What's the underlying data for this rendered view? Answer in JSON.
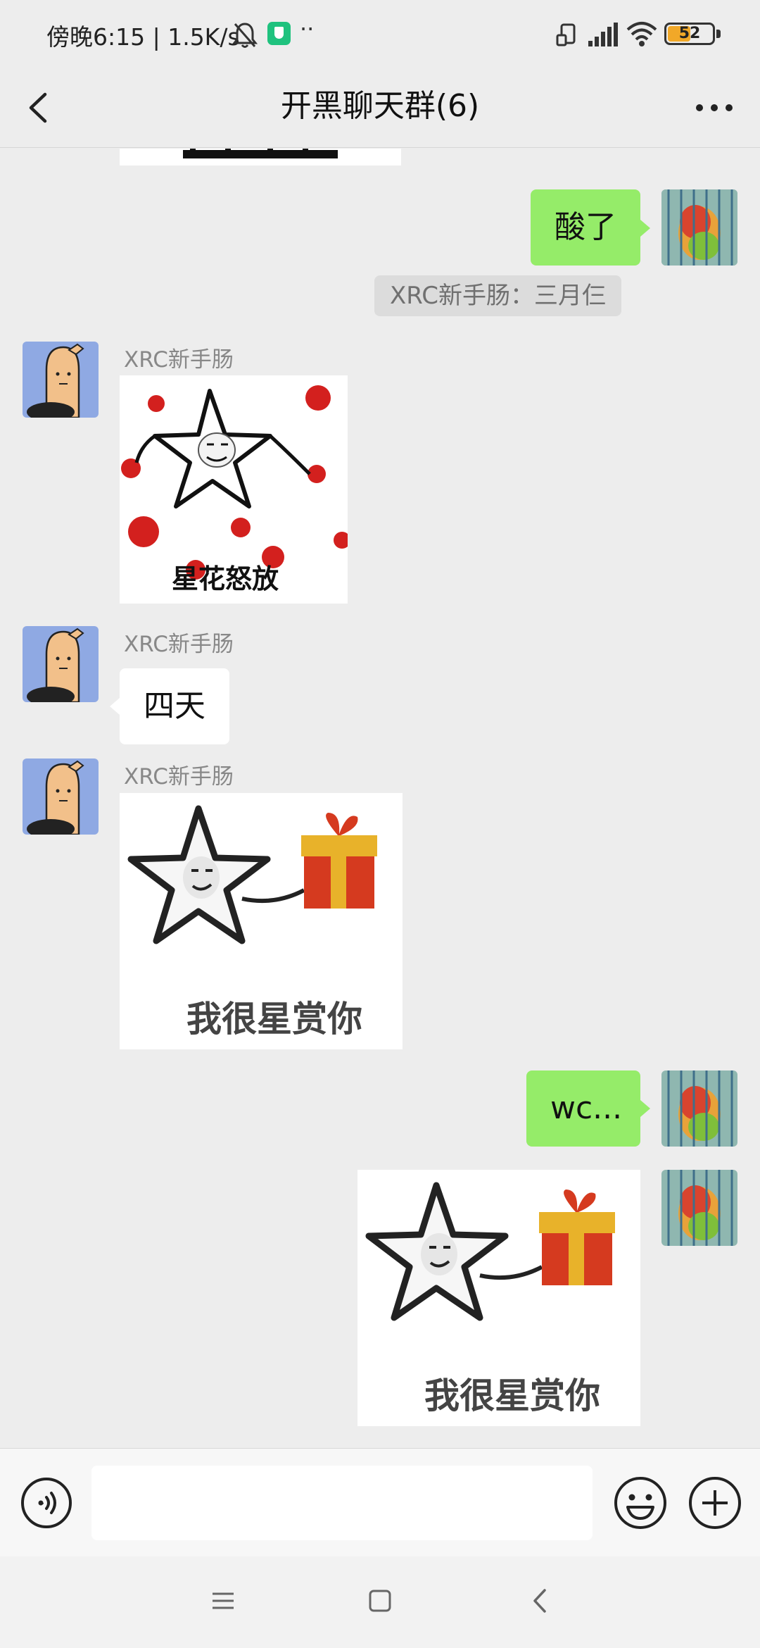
{
  "status_bar": {
    "time_speed": "傍晚6:15 | 1.5K/s",
    "dots": "··",
    "battery": "52",
    "battery_level": 0.52,
    "icons": [
      "bell-mute-icon",
      "shield-app-icon",
      "rotate-icon",
      "signal-icon",
      "wifi-icon",
      "battery-icon"
    ]
  },
  "header": {
    "title": "开黑聊天群(6)",
    "back_icon": "chevron-left-icon",
    "more_icon": "more-dots-icon"
  },
  "messages": {
    "top_sticker_caption": "",
    "msg1": {
      "text": "酸了",
      "from": "me"
    },
    "system": "XRC新手肠：三月仨",
    "msg2": {
      "sender": "XRC新手肠",
      "sticker_caption": "星花怒放"
    },
    "msg3": {
      "sender": "XRC新手肠",
      "text": "四天"
    },
    "msg4": {
      "sender": "XRC新手肠",
      "sticker_caption": "我很星赏你"
    },
    "msg5": {
      "text": "wc...",
      "from": "me"
    },
    "msg6": {
      "sticker_caption": "我很星赏你",
      "from": "me"
    }
  },
  "input_bar": {
    "placeholder": "",
    "icons": [
      "voice-icon",
      "emoji-icon",
      "plus-icon"
    ]
  },
  "nav_bar": {
    "icons": [
      "menu-icon",
      "home-icon",
      "back-icon"
    ]
  },
  "colors": {
    "my_bubble": "#95ec69",
    "other_bubble": "#ffffff",
    "background": "#ededed"
  }
}
